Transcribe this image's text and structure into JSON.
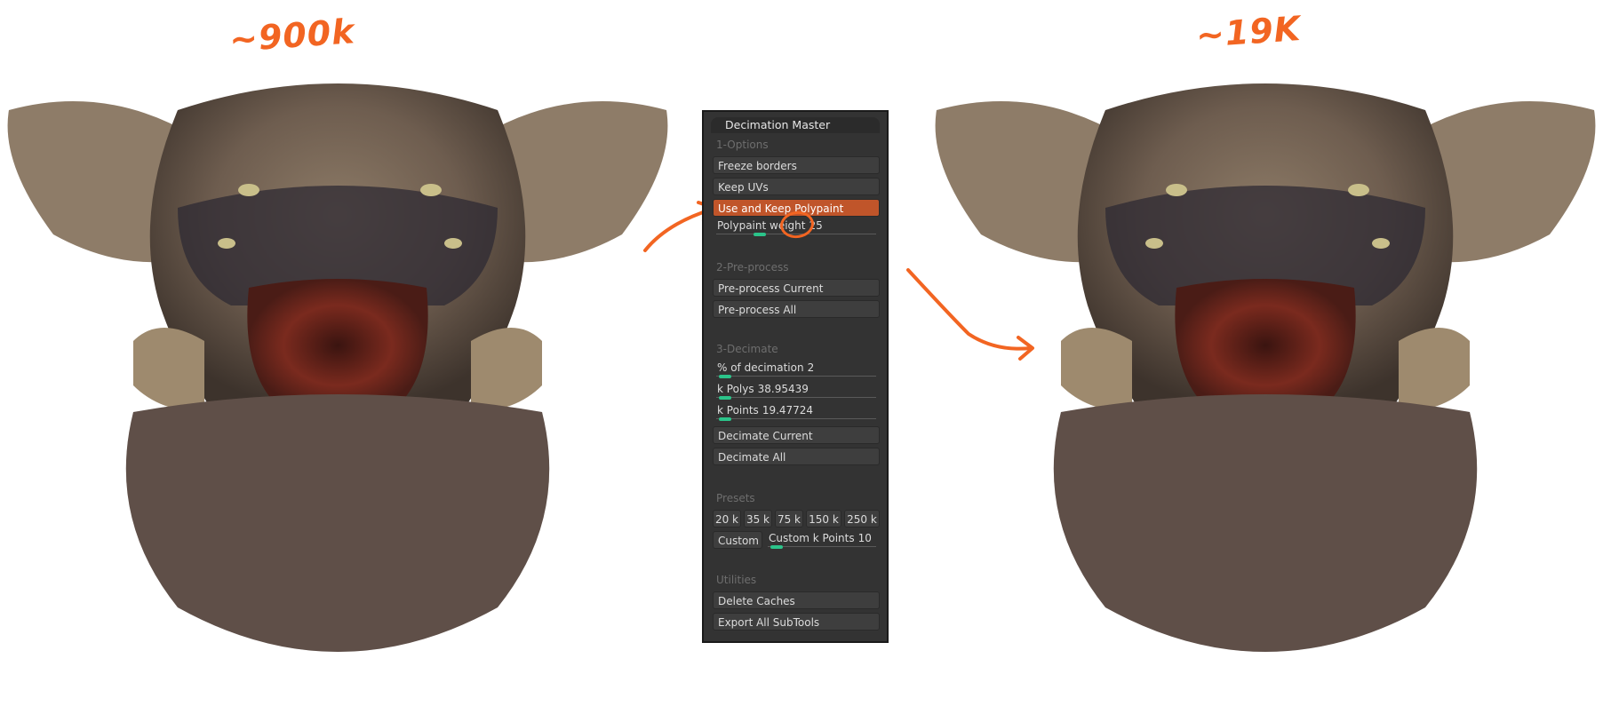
{
  "labels": {
    "left": "~900k",
    "right": "~19K"
  },
  "colors": {
    "accent": "#f26522",
    "active_button": "#c0552a",
    "slider_thumb": "#2bc48a",
    "panel_bg": "#333333"
  },
  "panel": {
    "title": "Decimation Master",
    "sections": {
      "options": "1-Options",
      "preprocess": "2-Pre-process",
      "decimate": "3-Decimate",
      "presets": "Presets",
      "utilities": "Utilities"
    },
    "buttons": {
      "freeze_borders": "Freeze borders",
      "keep_uvs": "Keep UVs",
      "use_keep_polypaint": "Use and Keep Polypaint",
      "preprocess_current": "Pre-process Current",
      "preprocess_all": "Pre-process All",
      "decimate_current": "Decimate Current",
      "decimate_all": "Decimate All",
      "custom": "Custom",
      "delete_caches": "Delete Caches",
      "export_all": "Export All SubTools"
    },
    "sliders": {
      "polypaint_weight": {
        "label": "Polypaint weight",
        "value": "25",
        "fraction": 0.25
      },
      "pct_decimation": {
        "label": "% of decimation",
        "value": "2",
        "fraction": 0.02
      },
      "k_polys": {
        "label": "k Polys",
        "value": "38.95439",
        "fraction": 0.02
      },
      "k_points": {
        "label": "k Points",
        "value": "19.47724",
        "fraction": 0.02
      },
      "custom_k_points": {
        "label": "Custom k Points",
        "value": "10",
        "fraction": 0.03
      }
    },
    "presets": [
      "20 k",
      "35 k",
      "75 k",
      "150 k",
      "250 k"
    ]
  }
}
